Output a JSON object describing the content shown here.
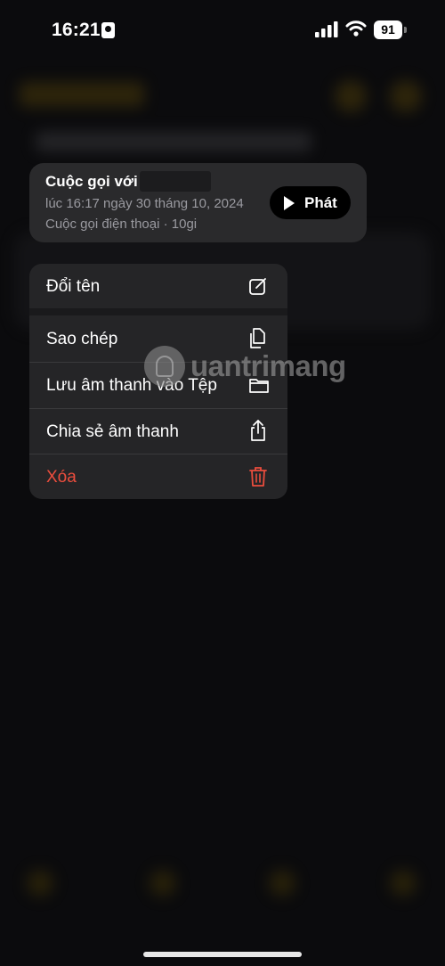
{
  "status_bar": {
    "time": "16:21",
    "battery": "91"
  },
  "recording": {
    "title": "Cuộc gọi với",
    "date": "lúc 16:17 ngày 30 tháng 10, 2024",
    "meta": "Cuộc gọi điện thoại · 10gi",
    "play_label": "Phát"
  },
  "menu": {
    "items": [
      {
        "label": "Đổi tên",
        "icon": "edit-icon"
      },
      {
        "label": "Sao chép",
        "icon": "copy-icon"
      },
      {
        "label": "Lưu âm thanh vào Tệp",
        "icon": "folder-icon"
      },
      {
        "label": "Chia sẻ âm thanh",
        "icon": "share-icon"
      },
      {
        "label": "Xóa",
        "icon": "trash-icon"
      }
    ]
  },
  "watermark": {
    "text": "uantrimang"
  },
  "colors": {
    "destructive": "#eb4d3d",
    "card": "#2a2a2c",
    "menu": "#252527"
  }
}
